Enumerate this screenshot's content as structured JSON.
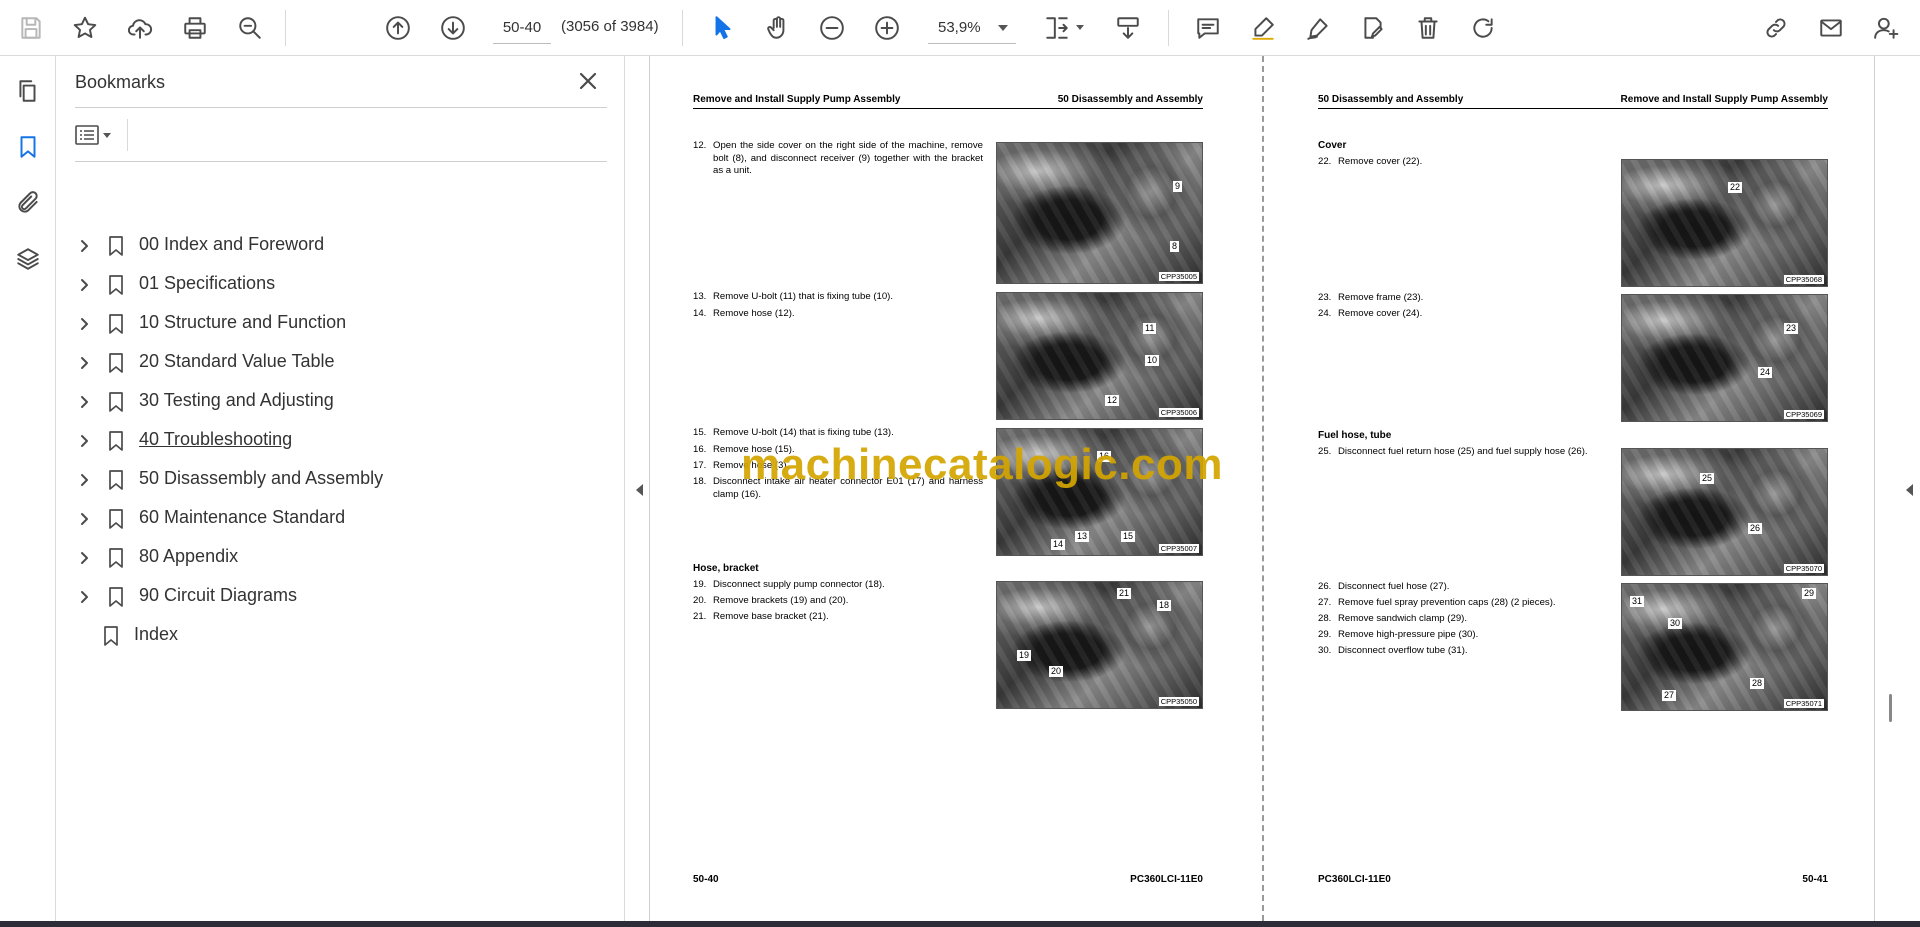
{
  "toolbar": {
    "page_field_value": "50-40",
    "page_count": "(3056 of 3984)",
    "zoom_value": "53,9%",
    "icons": [
      "save-icon",
      "bookmark-star-icon",
      "upload-cloud-icon",
      "print-icon",
      "zoom-search-icon",
      "previous-page-icon",
      "next-page-icon",
      "select-pointer-icon",
      "hand-tool-icon",
      "zoom-out-icon",
      "zoom-in-icon",
      "page-fit-icon",
      "scrolling-mode-icon",
      "comment-icon",
      "highlight-pen-icon",
      "sign-icon",
      "edit-pdf-icon",
      "delete-icon",
      "rotate-icon",
      "share-link-icon",
      "email-icon",
      "account-icon"
    ]
  },
  "leftrail": {
    "items": [
      "pages-thumbnail-icon",
      "bookmarks-icon",
      "attachments-icon",
      "layers-icon"
    ]
  },
  "bookmarks": {
    "title": "Bookmarks",
    "items": [
      {
        "label": "00 Index and Foreword",
        "expandable": true
      },
      {
        "label": "01 Specifications",
        "expandable": true
      },
      {
        "label": "10 Structure and Function",
        "expandable": true
      },
      {
        "label": "20 Standard Value Table",
        "expandable": true
      },
      {
        "label": "30 Testing and Adjusting",
        "expandable": true
      },
      {
        "label": "40 Troubleshooting",
        "expandable": true
      },
      {
        "label": "50 Disassembly and Assembly",
        "expandable": true
      },
      {
        "label": "60 Maintenance Standard",
        "expandable": true
      },
      {
        "label": "80 Appendix",
        "expandable": true
      },
      {
        "label": "90 Circuit Diagrams",
        "expandable": true
      },
      {
        "label": "Index",
        "expandable": false
      }
    ]
  },
  "document": {
    "left_page": {
      "header_left": "Remove and Install Supply Pump Assembly",
      "header_right": "50 Disassembly and Assembly",
      "steps": [
        {
          "n": "12.",
          "t": "Open the side cover on the right side of the machine, remove bolt (8), and disconnect receiver (9) together with the bracket as a unit."
        },
        {
          "n": "13.",
          "t": "Remove U-bolt (11) that is fixing tube (10)."
        },
        {
          "n": "14.",
          "t": "Remove hose (12)."
        },
        {
          "n": "15.",
          "t": "Remove U-bolt (14) that is fixing tube (13)."
        },
        {
          "n": "16.",
          "t": "Remove hose (15)."
        },
        {
          "n": "17.",
          "t": "Remove hose (3)."
        },
        {
          "n": "18.",
          "t": "Disconnect intake air heater connector E01 (17) and harness clamp (16)."
        },
        {
          "n": "19.",
          "t": "Disconnect supply pump connector (18)."
        },
        {
          "n": "20.",
          "t": "Remove brackets (19) and (20)."
        },
        {
          "n": "21.",
          "t": "Remove base bracket (21)."
        }
      ],
      "section_hose_bracket": "Hose, bracket",
      "photos": [
        {
          "cap": "CPP35005",
          "nums": [
            "9",
            "8"
          ]
        },
        {
          "cap": "CPP35006",
          "nums": [
            "11",
            "10",
            "12"
          ]
        },
        {
          "cap": "CPP35007",
          "nums": [
            "16",
            "14",
            "13",
            "15"
          ]
        },
        {
          "cap": "CPP35050",
          "nums": [
            "21",
            "18",
            "19",
            "20"
          ]
        }
      ],
      "footer_left": "50-40",
      "footer_right": "PC360LCI-11E0"
    },
    "right_page": {
      "header_left": "50 Disassembly and Assembly",
      "header_right": "Remove and Install Supply Pump Assembly",
      "section_cover": "Cover",
      "section_fuel": "Fuel hose, tube",
      "steps": [
        {
          "n": "22.",
          "t": "Remove cover (22)."
        },
        {
          "n": "23.",
          "t": "Remove frame (23)."
        },
        {
          "n": "24.",
          "t": "Remove cover (24)."
        },
        {
          "n": "25.",
          "t": "Disconnect fuel return hose (25) and fuel supply hose (26)."
        },
        {
          "n": "26.",
          "t": "Disconnect fuel hose (27)."
        },
        {
          "n": "27.",
          "t": "Remove fuel spray prevention caps (28) (2 pieces)."
        },
        {
          "n": "28.",
          "t": "Remove sandwich clamp (29)."
        },
        {
          "n": "29.",
          "t": "Remove high-pressure pipe (30)."
        },
        {
          "n": "30.",
          "t": "Disconnect overflow tube (31)."
        }
      ],
      "photos": [
        {
          "cap": "CPP35068",
          "nums": [
            "22"
          ]
        },
        {
          "cap": "CPP35069",
          "nums": [
            "23",
            "24"
          ]
        },
        {
          "cap": "CPP35070",
          "nums": [
            "25",
            "26"
          ]
        },
        {
          "cap": "CPP35071",
          "nums": [
            "31",
            "30",
            "29",
            "28",
            "27"
          ]
        }
      ],
      "footer_left": "PC360LCI-11E0",
      "footer_right": "50-41"
    },
    "watermark": "machinecatalogic.com"
  },
  "colors": {
    "accent": "#1473e6",
    "watermark": "#d4a500"
  }
}
